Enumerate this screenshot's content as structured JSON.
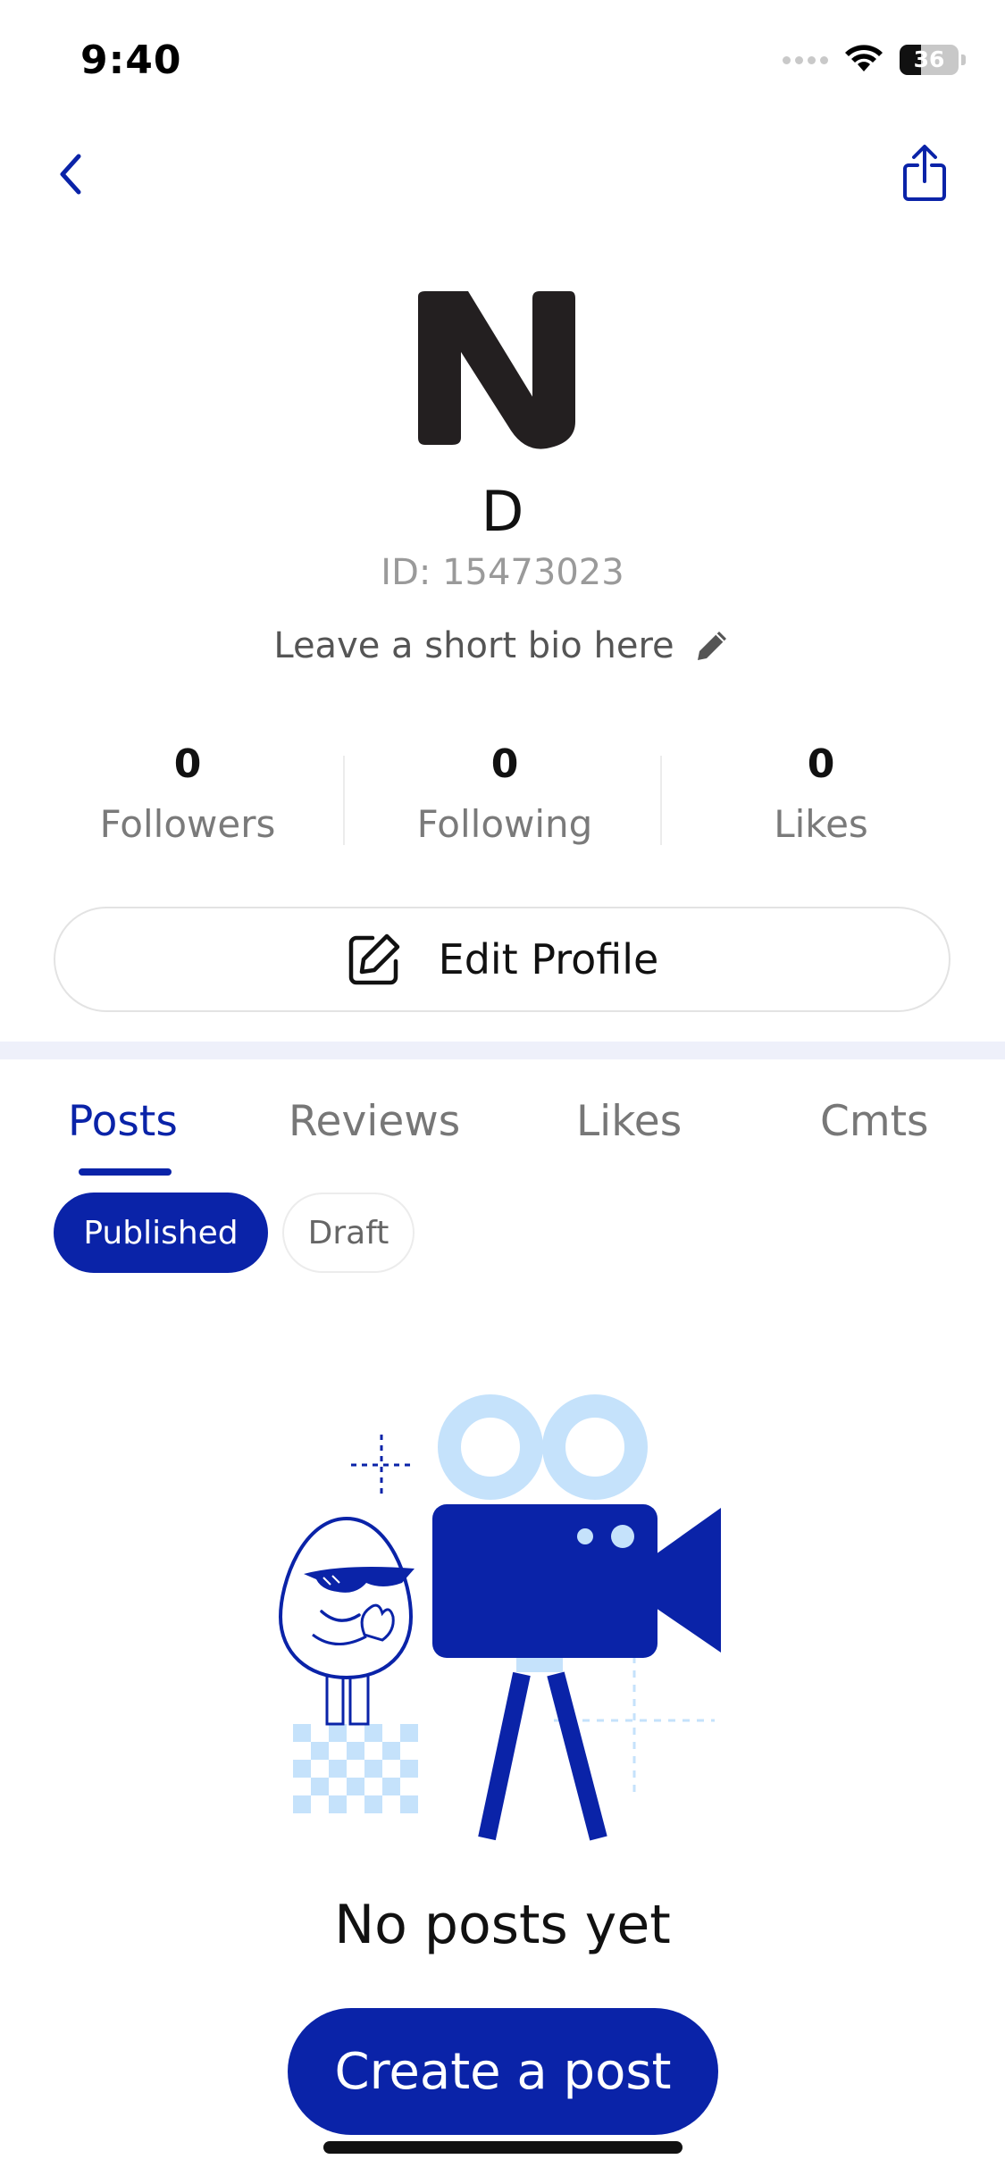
{
  "status_bar": {
    "time": "9:40",
    "battery_percent": "36",
    "battery_level": 0.36,
    "icons": [
      "signal-dots-icon",
      "wifi-icon",
      "battery-icon"
    ]
  },
  "nav": {
    "back_icon": "chevron-left-icon",
    "share_icon": "share-icon",
    "accent_color": "#0a23a8"
  },
  "profile": {
    "avatar_icon": "n-logo-icon",
    "name": "D",
    "id_text": "ID: 15473023",
    "bio_placeholder": "Leave a short bio here",
    "bio_edit_icon": "pencil-icon"
  },
  "stats": [
    {
      "value": "0",
      "label": "Followers"
    },
    {
      "value": "0",
      "label": "Following"
    },
    {
      "value": "0",
      "label": "Likes"
    }
  ],
  "edit_profile": {
    "label": "Edit Profile",
    "icon": "edit-square-icon"
  },
  "tabs": [
    {
      "label": "Posts",
      "active": true
    },
    {
      "label": "Reviews",
      "active": false
    },
    {
      "label": "Likes",
      "active": false
    },
    {
      "label": "Cmts",
      "active": false
    }
  ],
  "filters": [
    {
      "label": "Published",
      "selected": true
    },
    {
      "label": "Draft",
      "selected": false
    }
  ],
  "empty_state": {
    "illustration": "egg-character-with-video-camera-illustration",
    "message": "No posts yet",
    "cta_label": "Create a post"
  },
  "colors": {
    "primary": "#0a23a8",
    "light_blue": "#c5e2fb",
    "separator": "#eef0fa"
  }
}
